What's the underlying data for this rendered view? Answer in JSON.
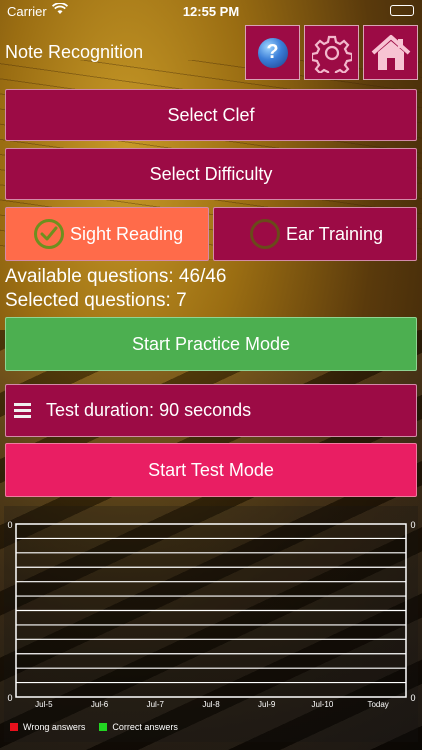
{
  "status_bar": {
    "carrier": "Carrier",
    "time": "12:55 PM"
  },
  "header": {
    "title": "Note Recognition"
  },
  "top_buttons": {
    "help_icon": "help-icon",
    "settings_icon": "gear-icon",
    "home_icon": "home-icon",
    "help_glyph": "?"
  },
  "menu": {
    "select_clef": "Select Clef",
    "select_difficulty": "Select Difficulty"
  },
  "modes": {
    "sight_reading": "Sight Reading",
    "ear_training": "Ear Training",
    "selected": "Sight Reading"
  },
  "info": {
    "available": "Available questions: 46/46",
    "selected": "Selected questions: 7"
  },
  "actions": {
    "practice": "Start Practice Mode",
    "test_duration": "Test duration: 90 seconds",
    "test": "Start Test Mode"
  },
  "colors": {
    "crimson": "#9c0b45",
    "coral": "#ff6b4a",
    "green": "#4caf50",
    "pink": "#e91e63"
  },
  "chart_data": {
    "type": "line",
    "categories": [
      "Jul-5",
      "Jul-6",
      "Jul-7",
      "Jul-8",
      "Jul-9",
      "Jul-10",
      "Today"
    ],
    "series": [
      {
        "name": "Wrong answers",
        "color": "#e8101c",
        "values": [
          0,
          0,
          0,
          0,
          0,
          0,
          0
        ]
      },
      {
        "name": "Correct answers",
        "color": "#22d622",
        "values": [
          0,
          0,
          0,
          0,
          0,
          0,
          0
        ]
      }
    ],
    "y_left_tick": "0",
    "y_right_tick": "0",
    "ylim": [
      0,
      0
    ],
    "grid": true,
    "legend": "bottom-left"
  }
}
